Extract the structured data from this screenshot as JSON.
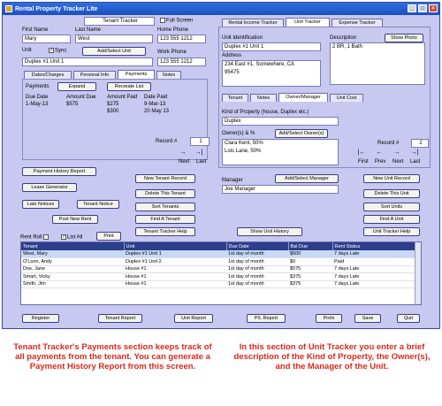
{
  "app": {
    "title": "Rental Property Tracker Lite"
  },
  "tenant": {
    "section_title": "Tenant Tracker",
    "full_screen_label": "Full Screen",
    "first_name_label": "First Name",
    "first_name": "Mary",
    "last_name_label": "Last Name",
    "last_name": "West",
    "home_phone_label": "Home Phone",
    "home_phone": "123 555 1212",
    "unit_label": "Unit",
    "sync_label": "Sync",
    "add_unit_label": "Add/Select Unit",
    "unit_value": "Duplex #1 Unit 1",
    "work_phone_label": "Work Phone",
    "work_phone": "123 555 1212",
    "tabs": [
      "Dates/Charges",
      "Personal Info",
      "Payments",
      "Notes"
    ],
    "payments_label": "Payments",
    "expand_label": "Expand",
    "recreate_label": "Recreate List",
    "pay_headers": [
      "Due Date",
      "Amount Due",
      "Amount Paid",
      "Date Paid"
    ],
    "pay_row1": [
      "1-May-13",
      "$575",
      "$275",
      "9-Mar-13"
    ],
    "pay_row2": [
      "",
      "",
      "$300",
      "20 May 13"
    ],
    "record_label": "Record #",
    "record_value": "1",
    "next_label": "Next",
    "last_label": "Last"
  },
  "tenant_buttons": {
    "payment_history": "Payment History Report",
    "lease_generator": "Lease Generator",
    "late_notices": "Late Notices",
    "tenant_notice": "Tenant Notice",
    "post_new_rent": "Post New Rent",
    "new_tenant": "New Tenant Record",
    "delete_tenant": "Delete This Tenant",
    "sort_tenants": "Sort Tenants",
    "find_tenant": "Find A Tenant",
    "tenant_help": "Tenant Tracker Help",
    "show_history": "Show Unit History"
  },
  "top_tabs": [
    "Rental Income Tracker",
    "Unit Tracker",
    "Expense Tracker"
  ],
  "unit": {
    "unit_id_label": "Unit Identification",
    "unit_id": "Duplex #1 Unit 1",
    "address_label": "Address",
    "address_line1": "234 East #1, Somewhere, CA",
    "address_line2": "95475",
    "description_label": "Description",
    "description": "2 BR, 1 Bath",
    "show_photo": "Show Photo",
    "tabs": [
      "Tenant",
      "Notes",
      "Owner/Manager",
      "Unit Cost"
    ],
    "kind_label": "Kind of Property (house, Duplex etc.)",
    "kind_value": "Duplex",
    "owners_label": "Owner(s) & %",
    "add_owner": "Add/Select Owner(s)",
    "owners_line1": "Clara Kent, 50%",
    "owners_line2": "Lois Lane, 50%",
    "manager_label": "Manager",
    "add_manager": "Add/Select Manager",
    "manager_value": "Joe Manager",
    "record_label": "Record #",
    "record_value": "2",
    "nav": [
      "First",
      "Prev",
      "Next",
      "Last"
    ]
  },
  "unit_buttons": {
    "new_unit": "New Unit Record",
    "delete_unit": "Delete This Unit",
    "sort_units": "Sort Units",
    "find_unit": "Find A Unit",
    "unit_help": "Unit Tracker Help"
  },
  "list": {
    "rent_roll_label": "Rent Roll",
    "list_all_label": "List All",
    "print_label": "Print",
    "columns": [
      "Tenant",
      "Unit",
      "Due Date",
      "Bal Due",
      "Rent Status"
    ],
    "rows": [
      [
        "West, Mary",
        "Duplex #1 Unit 1",
        "1st day of month",
        "$600",
        "7 days Late"
      ],
      [
        "O'Lunn, Andy",
        "Duplex #1 Unit 2",
        "1st day of month",
        "$0",
        "Paid"
      ],
      [
        "Doe, Jane",
        "House #1",
        "1st day of month",
        "$575",
        "7 days Late"
      ],
      [
        "Smart, Vicky",
        "House #1",
        "1st day of month",
        "$375",
        "7 days Late"
      ],
      [
        "Smith, Jim",
        "House #1",
        "1st day of month",
        "$375",
        "7 days Late"
      ]
    ]
  },
  "footer_buttons": [
    "Register",
    "Tenant Report",
    "Unit Report",
    "P/L Report",
    "Prefs",
    "Save",
    "Quit"
  ],
  "captions": {
    "left": "Tenant Tracker's Payments section keeps track of all payments from the tenant. You can generate a Payment History Report from this screen.",
    "right": "In this section of Unit Tracker you enter a brief description of the Kind of Property, the Owner(s), and the Manager of the Unit."
  }
}
